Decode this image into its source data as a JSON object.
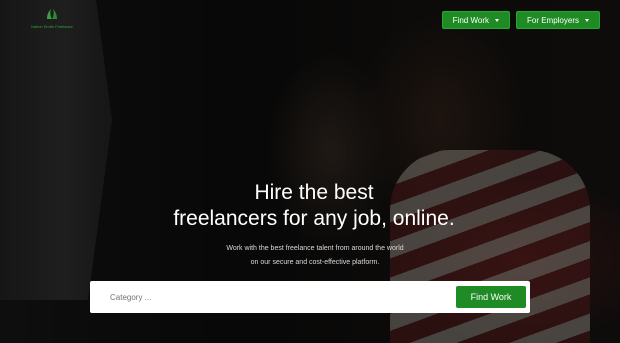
{
  "header": {
    "logo_text": "Nation Smith Freelance",
    "nav": [
      {
        "label": "Find Work"
      },
      {
        "label": "For Employers"
      }
    ]
  },
  "hero": {
    "title_line1": "Hire the best",
    "title_line2": "freelancers for any job, online.",
    "subtitle_line1": "Work with the best freelance talent from around the world",
    "subtitle_line2": "on our secure and cost-effective platform."
  },
  "search": {
    "placeholder": "Category ...",
    "button_label": "Find Work"
  },
  "colors": {
    "accent": "#1f8b24",
    "logo": "#3aa23a"
  }
}
